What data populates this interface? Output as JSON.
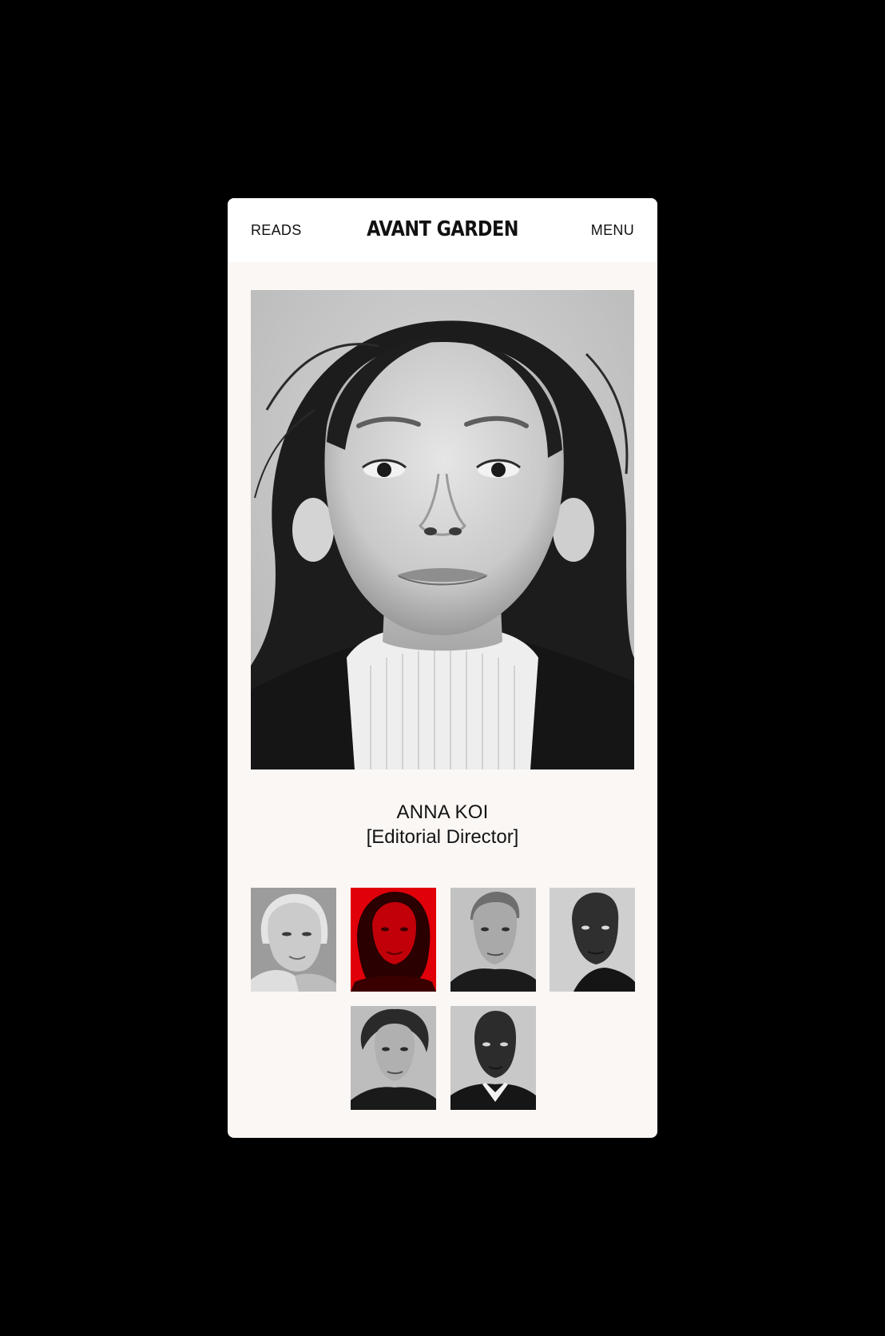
{
  "header": {
    "reads_label": "READS",
    "brand": "AVANT GARDEN",
    "menu_label": "MENU"
  },
  "profile": {
    "name": "ANNA KOI",
    "role": "[Editorial Director]"
  },
  "colors": {
    "background": "#000000",
    "card": "#fbf7f5",
    "header": "#ffffff",
    "accent_red": "#e0000a",
    "text": "#111111"
  },
  "thumbnails": [
    {
      "name": "portrait-thumb-1",
      "selected": false
    },
    {
      "name": "portrait-thumb-2",
      "selected": true
    },
    {
      "name": "portrait-thumb-3",
      "selected": false
    },
    {
      "name": "portrait-thumb-4",
      "selected": false
    },
    {
      "name": "portrait-thumb-5",
      "selected": false
    },
    {
      "name": "portrait-thumb-6",
      "selected": false
    }
  ]
}
